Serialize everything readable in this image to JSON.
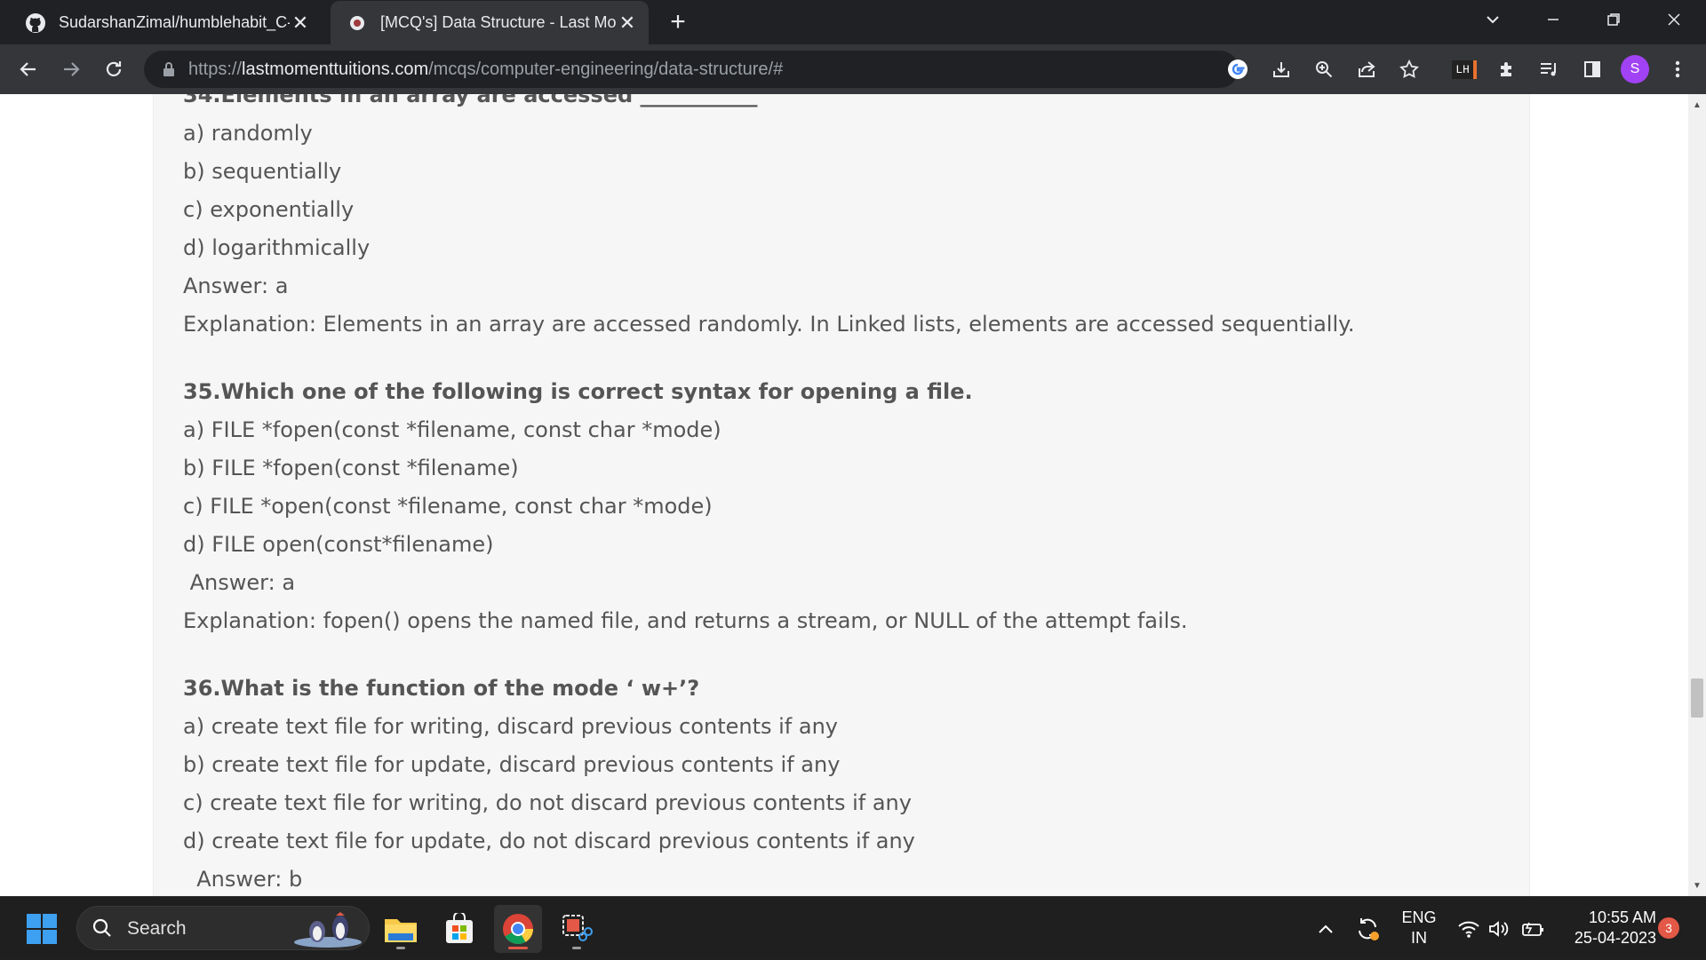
{
  "browser": {
    "tabs": [
      {
        "title": "SudarshanZimal/humblehabit_C-",
        "active": false
      },
      {
        "title": "[MCQ's] Data Structure - Last Mo",
        "active": true
      }
    ],
    "url_prefix": "https://",
    "url_domain": "lastmomenttuitions.com",
    "url_path": "/mcqs/computer-engineering/data-structure/#",
    "profile_initial": "S",
    "extension_badge": "LH"
  },
  "page": {
    "blocks": [
      {
        "kind": "question",
        "text": "34.Elements in an array are accessed ___________"
      },
      {
        "kind": "option",
        "text": "a) randomly"
      },
      {
        "kind": "option",
        "text": "b) sequentially"
      },
      {
        "kind": "option",
        "text": "c) exponentially"
      },
      {
        "kind": "option",
        "text": "d) logarithmically"
      },
      {
        "kind": "answer",
        "text": "Answer: a"
      },
      {
        "kind": "explanation",
        "text": "Explanation: Elements in an array are accessed randomly. In Linked lists, elements are accessed sequentially."
      },
      {
        "kind": "gap",
        "text": ""
      },
      {
        "kind": "question",
        "text": "35.Which one of the following is correct syntax for opening a file."
      },
      {
        "kind": "option",
        "text": "a) FILE *fopen(const *filename, const char *mode)"
      },
      {
        "kind": "option",
        "text": "b) FILE *fopen(const *filename)"
      },
      {
        "kind": "option",
        "text": "c) FILE *open(const *filename, const char *mode)"
      },
      {
        "kind": "option",
        "text": "d) FILE open(const*filename)"
      },
      {
        "kind": "answer",
        "text": " Answer: a"
      },
      {
        "kind": "explanation",
        "text": "Explanation: fopen() opens the named file, and returns a stream, or NULL of the attempt fails."
      },
      {
        "kind": "gap",
        "text": ""
      },
      {
        "kind": "question",
        "text": "36.What is the function of the mode ‘ w+’?"
      },
      {
        "kind": "option",
        "text": "a) create text file for writing, discard previous contents if any"
      },
      {
        "kind": "option",
        "text": "b) create text file for update, discard previous contents if any"
      },
      {
        "kind": "option",
        "text": "c) create text file for writing, do not discard previous contents if any"
      },
      {
        "kind": "option",
        "text": "d) create text file for update, do not discard previous contents if any"
      },
      {
        "kind": "answer",
        "text": "  Answer: b"
      }
    ]
  },
  "taskbar": {
    "search_label": "Search",
    "language": "ENG",
    "region": "IN",
    "time": "10:55 AM",
    "date": "25-04-2023",
    "notification_count": "3"
  },
  "colors": {
    "chrome_dark": "#202124",
    "toolbar": "#35363a",
    "page_card": "#f6f6f6",
    "text": "#555555",
    "avatar": "#a142f4"
  }
}
